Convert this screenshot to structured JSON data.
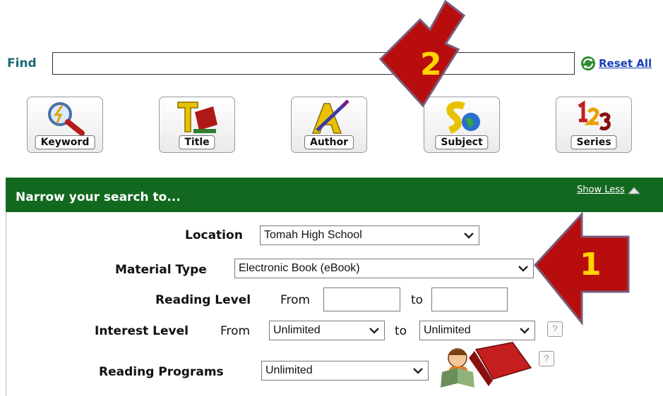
{
  "find": {
    "label": "Find",
    "value": ""
  },
  "reset": {
    "label": "Reset All"
  },
  "search_buttons": [
    {
      "label": "Keyword",
      "icon": "magnifier-icon"
    },
    {
      "label": "Title",
      "icon": "title-book-icon"
    },
    {
      "label": "Author",
      "icon": "author-quill-icon"
    },
    {
      "label": "Subject",
      "icon": "subject-globe-icon"
    },
    {
      "label": "Series",
      "icon": "series-123-icon"
    }
  ],
  "narrow": {
    "title": "Narrow your search to...",
    "show_less": "Show Less",
    "location": {
      "label": "Location",
      "value": "Tomah High School"
    },
    "material_type": {
      "label": "Material Type",
      "value": "Electronic Book (eBook)"
    },
    "reading_level": {
      "label": "Reading Level",
      "from": "From",
      "to": "to"
    },
    "interest_level": {
      "label": "Interest Level",
      "from": "From",
      "from_value": "Unlimited",
      "to": "to",
      "to_value": "Unlimited"
    },
    "reading_programs": {
      "label": "Reading Programs",
      "value": "Unlimited"
    },
    "help_glyph": "?"
  },
  "annotations": {
    "arrow1": "1",
    "arrow2": "2"
  },
  "colors": {
    "panel_header": "#13681f",
    "arrow_fill": "#b80d0d",
    "arrow_number": "#ffd400",
    "find_label": "#1a6b73",
    "link": "#1a3fb8"
  }
}
